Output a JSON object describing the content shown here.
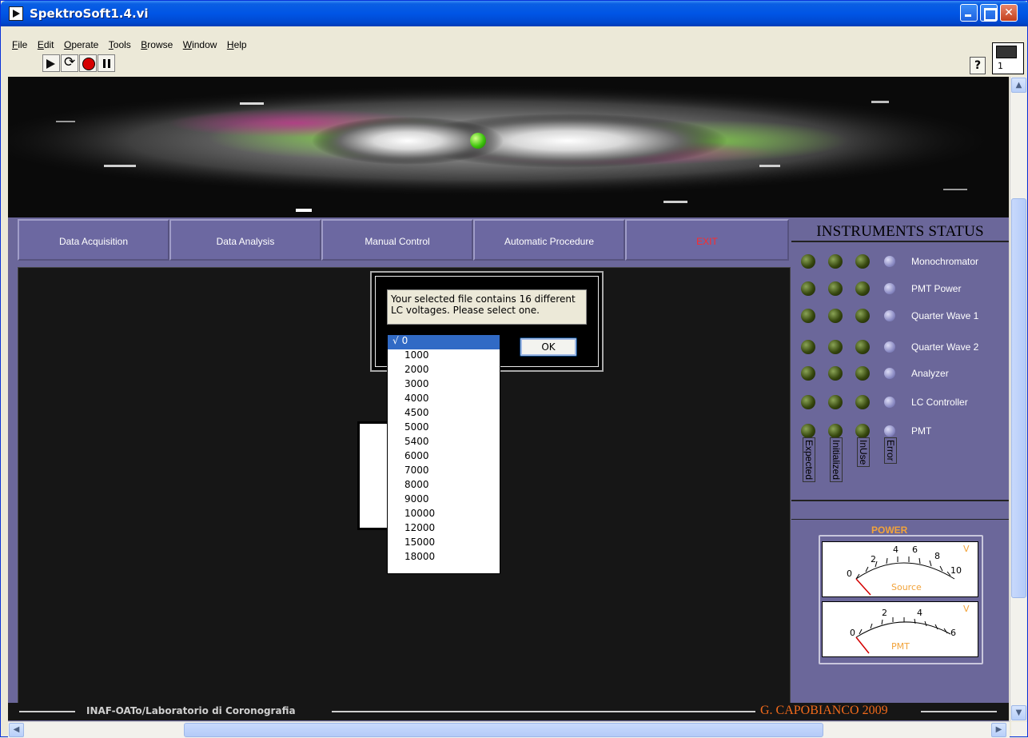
{
  "window": {
    "title": "SpektroSoft1.4.vi"
  },
  "menu": [
    "File",
    "Edit",
    "Operate",
    "Tools",
    "Browse",
    "Window",
    "Help"
  ],
  "toolbar": {
    "help_label": "?",
    "vi_icon_number": "1"
  },
  "tabs": [
    {
      "label": "Data Acquisition"
    },
    {
      "label": "Data Analysis"
    },
    {
      "label": "Manual Control"
    },
    {
      "label": "Automatic Procedure"
    },
    {
      "label": "EXIT"
    }
  ],
  "dialog": {
    "message": "Your selected file contains 16 different LC voltages. Please select one.",
    "ok_label": "OK",
    "dropdown": {
      "selected": "0",
      "check": "√",
      "options": [
        "0",
        "1000",
        "2000",
        "3000",
        "4000",
        "4500",
        "5000",
        "5400",
        "6000",
        "7000",
        "8000",
        "9000",
        "10000",
        "12000",
        "15000",
        "18000"
      ]
    }
  },
  "instruments": {
    "title": "INSTRUMENTS STATUS",
    "items": [
      "Monochromator",
      "PMT Power",
      "Quarter Wave 1",
      "Quarter Wave 2",
      "Analyzer",
      "LC Controller",
      "PMT"
    ],
    "columns": [
      "Expected",
      "Initialized",
      "InUse",
      "Error"
    ],
    "colors": {
      "led_green_off": "#37480f",
      "led_blue_off": "#8d8dc5"
    }
  },
  "power": {
    "title": "POWER",
    "meters": [
      {
        "label": "Source",
        "unit": "V",
        "ticks": [
          "0",
          "2",
          "4",
          "6",
          "8",
          "10"
        ],
        "value": 0
      },
      {
        "label": "PMT",
        "unit": "V",
        "ticks": [
          "0",
          "2",
          "4",
          "6"
        ],
        "value": 0
      }
    ]
  },
  "footer": {
    "left": "INAF-OATo/Laboratorio di Coronografia",
    "right": "G. CAPOBIANCO 2009"
  },
  "colors": {
    "panel_bg": "#6b679a",
    "exit_text": "#ff2a2a",
    "power_accent": "#f2a33a",
    "credit_accent": "#f26a1b",
    "selection": "#316ac5"
  }
}
